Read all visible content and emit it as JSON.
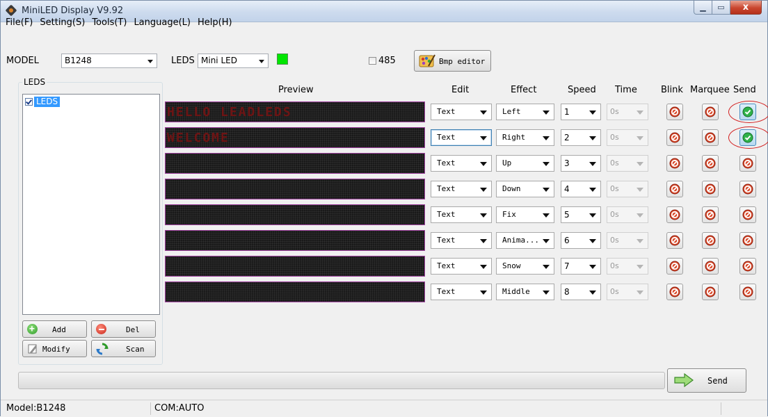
{
  "window": {
    "title": "MiniLED Display V9.92",
    "minimize_glyph": "▁",
    "maximize_glyph": "▭",
    "close_glyph": "x"
  },
  "menu": [
    "File(F)",
    "Setting(S)",
    "Tools(T)",
    "Language(L)",
    "Help(H)"
  ],
  "toolbar": {
    "model_label": "MODEL",
    "model_value": "B1248",
    "leds_label": "LEDS",
    "leds_value": "Mini LED",
    "swatch_color": "#00e600",
    "rs485_label": "485",
    "rs485_checked": false,
    "bmp_editor_label": "Bmp editor"
  },
  "leds_panel": {
    "title": "LEDS",
    "items": [
      {
        "label": "LEDS",
        "checked": true,
        "selected": true
      }
    ],
    "buttons": {
      "add": "Add",
      "del": "Del",
      "modify": "Modify",
      "scan": "Scan"
    }
  },
  "columns": {
    "preview": "Preview",
    "edit": "Edit",
    "effect": "Effect",
    "speed": "Speed",
    "time": "Time",
    "blink": "Blink",
    "marquee": "Marquee",
    "send": "Send"
  },
  "rows": [
    {
      "preview": "HELLO LEADLEDS",
      "edit": "Text",
      "effect": "Left",
      "speed": "1",
      "time": "0s",
      "blink": false,
      "marquee": false,
      "send": true
    },
    {
      "preview": "WELCOME",
      "edit": "Text",
      "effect": "Right",
      "speed": "2",
      "time": "0s",
      "blink": false,
      "marquee": false,
      "send": true
    },
    {
      "preview": "",
      "edit": "Text",
      "effect": "Up",
      "speed": "3",
      "time": "0s",
      "blink": false,
      "marquee": false,
      "send": false
    },
    {
      "preview": "",
      "edit": "Text",
      "effect": "Down",
      "speed": "4",
      "time": "0s",
      "blink": false,
      "marquee": false,
      "send": false
    },
    {
      "preview": "",
      "edit": "Text",
      "effect": "Fix",
      "speed": "5",
      "time": "0s",
      "blink": false,
      "marquee": false,
      "send": false
    },
    {
      "preview": "",
      "edit": "Text",
      "effect": "Anima...",
      "speed": "6",
      "time": "0s",
      "blink": false,
      "marquee": false,
      "send": false
    },
    {
      "preview": "",
      "edit": "Text",
      "effect": "Snow",
      "speed": "7",
      "time": "0s",
      "blink": false,
      "marquee": false,
      "send": false
    },
    {
      "preview": "",
      "edit": "Text",
      "effect": "Middle",
      "speed": "8",
      "time": "0s",
      "blink": false,
      "marquee": false,
      "send": false
    }
  ],
  "send_button": {
    "label": "Send"
  },
  "progress": {
    "value": 0
  },
  "status": {
    "model": "Model:B1248",
    "com": "COM:AUTO"
  },
  "colors": {
    "preview_text": "#6e1414",
    "preview_border": "#9b3c9b",
    "send_on": "#2fb34a",
    "disabled_icon": "#d94a2b",
    "highlight_ring": "#d21d1d"
  }
}
